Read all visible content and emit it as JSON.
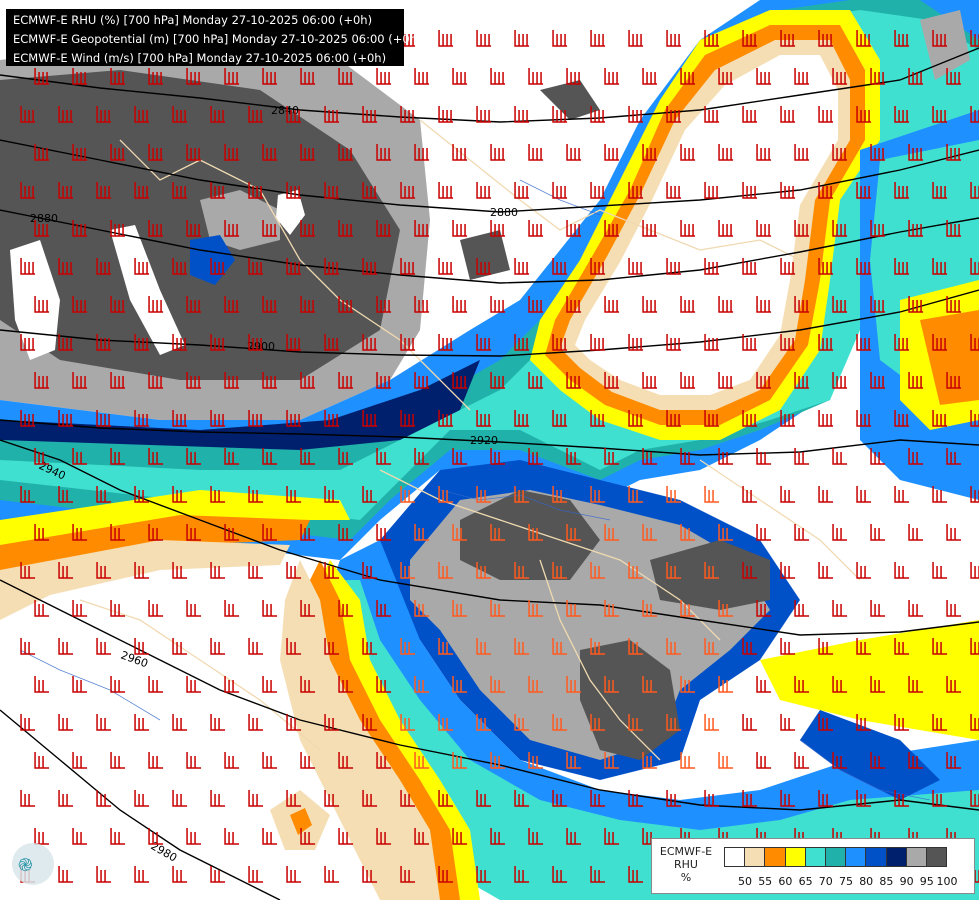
{
  "header": {
    "line1": "ECMWF-E RHU (%) [700 hPa] Monday 27-10-2025 06:00 (+0h)",
    "line2": "ECMWF-E Geopotential (m) [700 hPa] Monday 27-10-2025 06:00 (+0h)",
    "line3": "ECMWF-E Wind (m/s) [700 hPa] Monday 27-10-2025 06:00 (+0h)"
  },
  "legend": {
    "title_line1": "ECMWF-E",
    "title_line2": "RHU",
    "title_line3": "%",
    "swatches": [
      "#ffffff",
      "#f5deb3",
      "#ff8c00",
      "#ffff00",
      "#40e0d0",
      "#20b2aa",
      "#1e90ff",
      "#0050c8",
      "#00206e",
      "#a9a9a9",
      "#555555"
    ],
    "ticks": [
      "50",
      "55",
      "60",
      "65",
      "70",
      "75",
      "80",
      "85",
      "90",
      "95",
      "100"
    ]
  },
  "contours": [
    {
      "label": "2840"
    },
    {
      "label": "2880"
    },
    {
      "label": "2880"
    },
    {
      "label": "2900"
    },
    {
      "label": "2920"
    },
    {
      "label": "2940"
    },
    {
      "label": "2960"
    },
    {
      "label": "2980"
    }
  ],
  "colors": {
    "barb_red": "#c80000",
    "barb_orange": "#ff5a1e",
    "border": "#f0d9b0",
    "river": "#3366cc",
    "contour": "#000000"
  }
}
